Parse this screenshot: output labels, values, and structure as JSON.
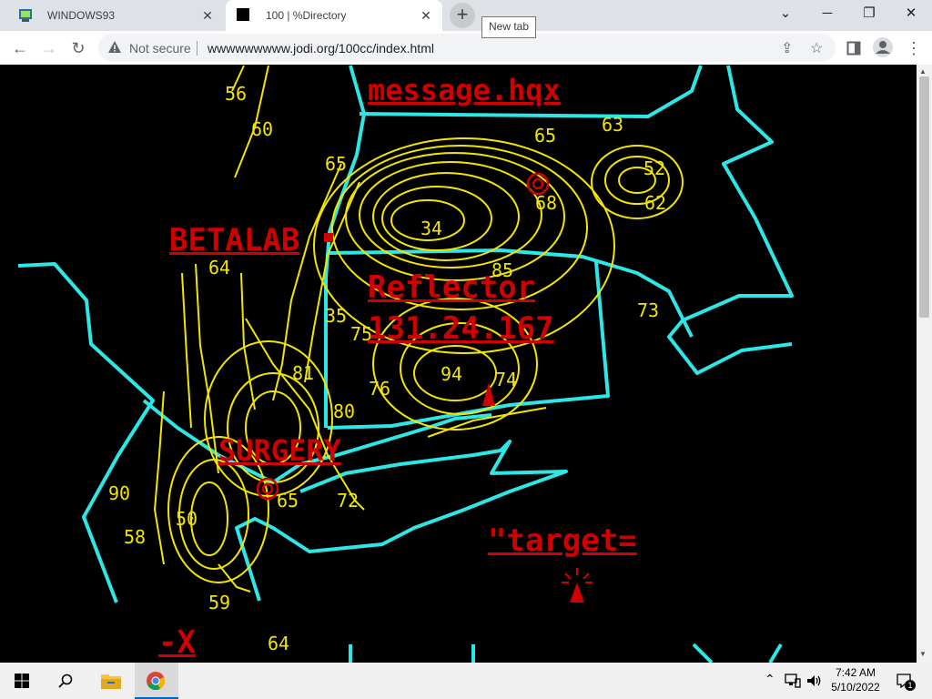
{
  "tabs": [
    {
      "title": "WINDOWS93",
      "close": "✕"
    },
    {
      "title": "100 | %Directory",
      "close": "✕"
    }
  ],
  "new_tab": {
    "symbol": "+",
    "tooltip": "New tab"
  },
  "window_controls": {
    "minimize": "─",
    "maximize": "❐",
    "close": "✕",
    "tabsearch": "⌄"
  },
  "toolbar": {
    "back": "←",
    "forward": "→",
    "reload": "↻",
    "security": "Not secure",
    "url": "wwwwwwwww.jodi.org/100cc/index.html",
    "share": "⇪",
    "bookmark": "☆",
    "menu": "⋮"
  },
  "page": {
    "labels": {
      "message": "message.hqx",
      "betalab": "BETALAB",
      "reflector": "Reflector",
      "ip": "131.24.167",
      "surgery": "SURGERY",
      "target": "\"target=",
      "minus_x": "-X"
    },
    "numbers": [
      "56",
      "60",
      "65",
      "65",
      "63",
      "52",
      "62",
      "68",
      "34",
      "64",
      "85",
      "35",
      "73",
      "75",
      "81",
      "76",
      "94",
      "74",
      "80",
      "90",
      "58",
      "59",
      "64",
      "72",
      "65",
      "50"
    ],
    "colors": {
      "contour": "#f2e600",
      "border": "#2de6e6",
      "label": "#d10000",
      "background": "#000000"
    }
  },
  "taskbar": {
    "time": "7:42 AM",
    "date": "5/10/2022",
    "notifications": "1"
  }
}
